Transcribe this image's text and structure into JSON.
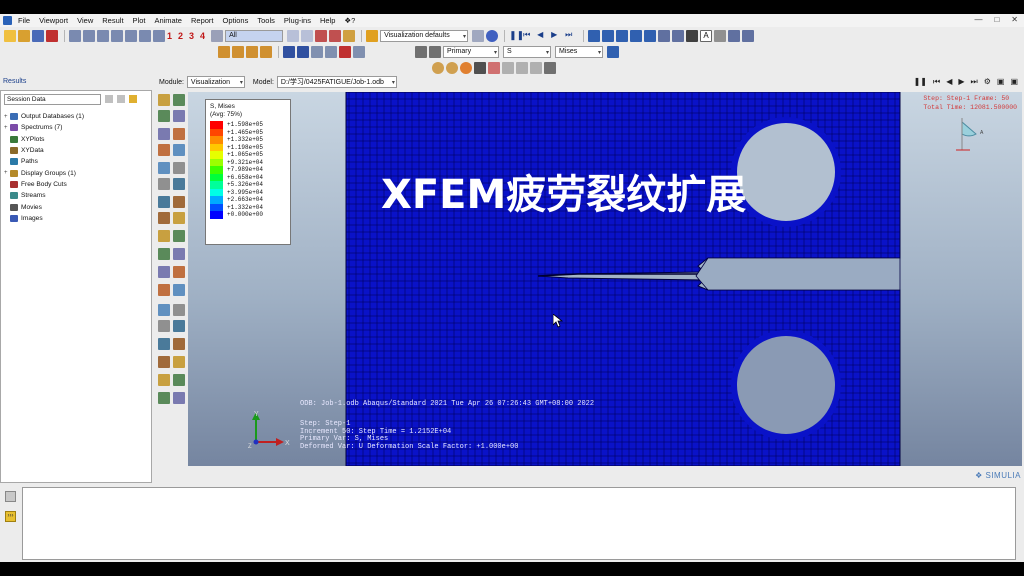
{
  "menu": {
    "items": [
      "File",
      "Viewport",
      "View",
      "Result",
      "Plot",
      "Animate",
      "Report",
      "Options",
      "Tools",
      "Plug-ins",
      "Help",
      "❖?"
    ],
    "win_controls": [
      "—",
      "□",
      "✕"
    ]
  },
  "toolbar": {
    "render_numbers": [
      "1",
      "2",
      "3",
      "4"
    ],
    "select_filter": "All",
    "vis_defaults": "Visualization defaults",
    "field_output": {
      "category": "Primary",
      "variable": "S",
      "invariant": "Mises"
    }
  },
  "module_row": {
    "module_label": "Module:",
    "module_value": "Visualization",
    "model_label": "Model:",
    "model_value": "D:/学习/0425FATIGUE/Job-1.odb"
  },
  "left_panel": {
    "tab": "Results",
    "session": "Session Data",
    "tree": [
      {
        "label": "Output Databases (1)",
        "expand": "+",
        "color": "#3a6db5"
      },
      {
        "label": "Spectrums (7)",
        "expand": "+",
        "color": "#7c4ca8"
      },
      {
        "label": "XYPlots",
        "expand": "",
        "color": "#3a7a3a"
      },
      {
        "label": "XYData",
        "expand": "",
        "color": "#8a6a2a"
      },
      {
        "label": "Paths",
        "expand": "",
        "color": "#2a7aa8"
      },
      {
        "label": "Display Groups (1)",
        "expand": "+",
        "color": "#b58a2a"
      },
      {
        "label": "Free Body Cuts",
        "expand": "",
        "color": "#a83030"
      },
      {
        "label": "Streams",
        "expand": "",
        "color": "#3a8a8a"
      },
      {
        "label": "Movies",
        "expand": "",
        "color": "#555555"
      },
      {
        "label": "Images",
        "expand": "",
        "color": "#3a5ab5"
      }
    ]
  },
  "legend": {
    "title": "S, Mises",
    "subtitle": "(Avg: 75%)",
    "rows": [
      {
        "value": "+1.598e+05",
        "color": "#ff0000"
      },
      {
        "value": "+1.465e+05",
        "color": "#ff4600"
      },
      {
        "value": "+1.332e+05",
        "color": "#ff8c00"
      },
      {
        "value": "+1.198e+05",
        "color": "#ffc800"
      },
      {
        "value": "+1.065e+05",
        "color": "#e6ff00"
      },
      {
        "value": "+9.321e+04",
        "color": "#9bff00"
      },
      {
        "value": "+7.989e+04",
        "color": "#3cff00"
      },
      {
        "value": "+6.658e+04",
        "color": "#00ff3a"
      },
      {
        "value": "+5.326e+04",
        "color": "#00ff9a"
      },
      {
        "value": "+3.995e+04",
        "color": "#00ffe6"
      },
      {
        "value": "+2.663e+04",
        "color": "#00aaff"
      },
      {
        "value": "+1.332e+04",
        "color": "#0050ff"
      },
      {
        "value": "+0.000e+00",
        "color": "#0000ff"
      }
    ]
  },
  "viewport": {
    "overlay_title": "XFEM疲劳裂纹扩展",
    "step_info": [
      "Step: Step-1   Frame: 50",
      "Total Time: 12081.500000"
    ],
    "odb_line": "ODB: Job-1.odb    Abaqus/Standard 2021    Tue Apr 26 07:26:43 GMT+08:00 2022",
    "step_block": [
      "Step: Step-1",
      "Increment   50: Step Time =   1.2152E+04",
      "Primary Var: S, Mises",
      "Deformed Var: U   Deformation Scale Factor: +1.000e+00"
    ],
    "triad": {
      "y": "Y",
      "x": "X",
      "z": "Z"
    },
    "mesh_color": "#0a12c8",
    "mesh_line_color": "#000060"
  },
  "brand": "SIMULIA"
}
